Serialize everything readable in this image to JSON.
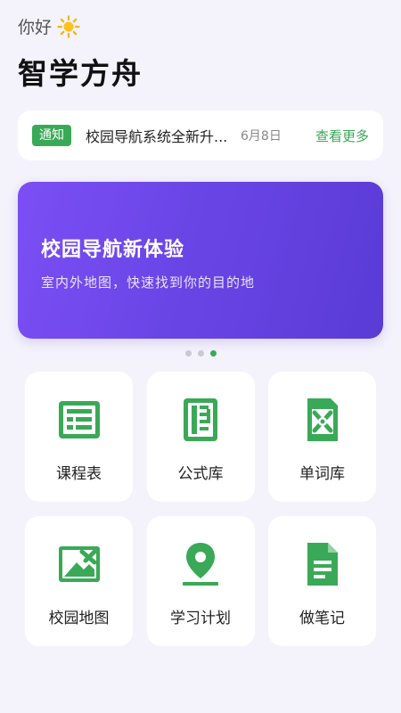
{
  "header": {
    "greeting": "你好",
    "greeting_icon": "sun-icon",
    "app_title": "智学方舟"
  },
  "notice": {
    "badge": "通知",
    "text": "校园导航系统全新升...",
    "date": "6月8日",
    "more_label": "查看更多"
  },
  "banner": {
    "title": "校园导航新体验",
    "subtitle": "室内外地图，快速找到你的目的地",
    "slide_count": 3,
    "active_slide": 3
  },
  "colors": {
    "accent_green": "#3aa957",
    "banner_purple": "#6a45e6",
    "background": "#f4f2fb"
  },
  "features": [
    {
      "label": "课程表",
      "icon": "timetable-icon"
    },
    {
      "label": "公式库",
      "icon": "formula-book-icon"
    },
    {
      "label": "单词库",
      "icon": "vocabulary-icon"
    },
    {
      "label": "校园地图",
      "icon": "campus-map-icon"
    },
    {
      "label": "学习计划",
      "icon": "location-pin-icon"
    },
    {
      "label": "做笔记",
      "icon": "note-document-icon"
    }
  ]
}
